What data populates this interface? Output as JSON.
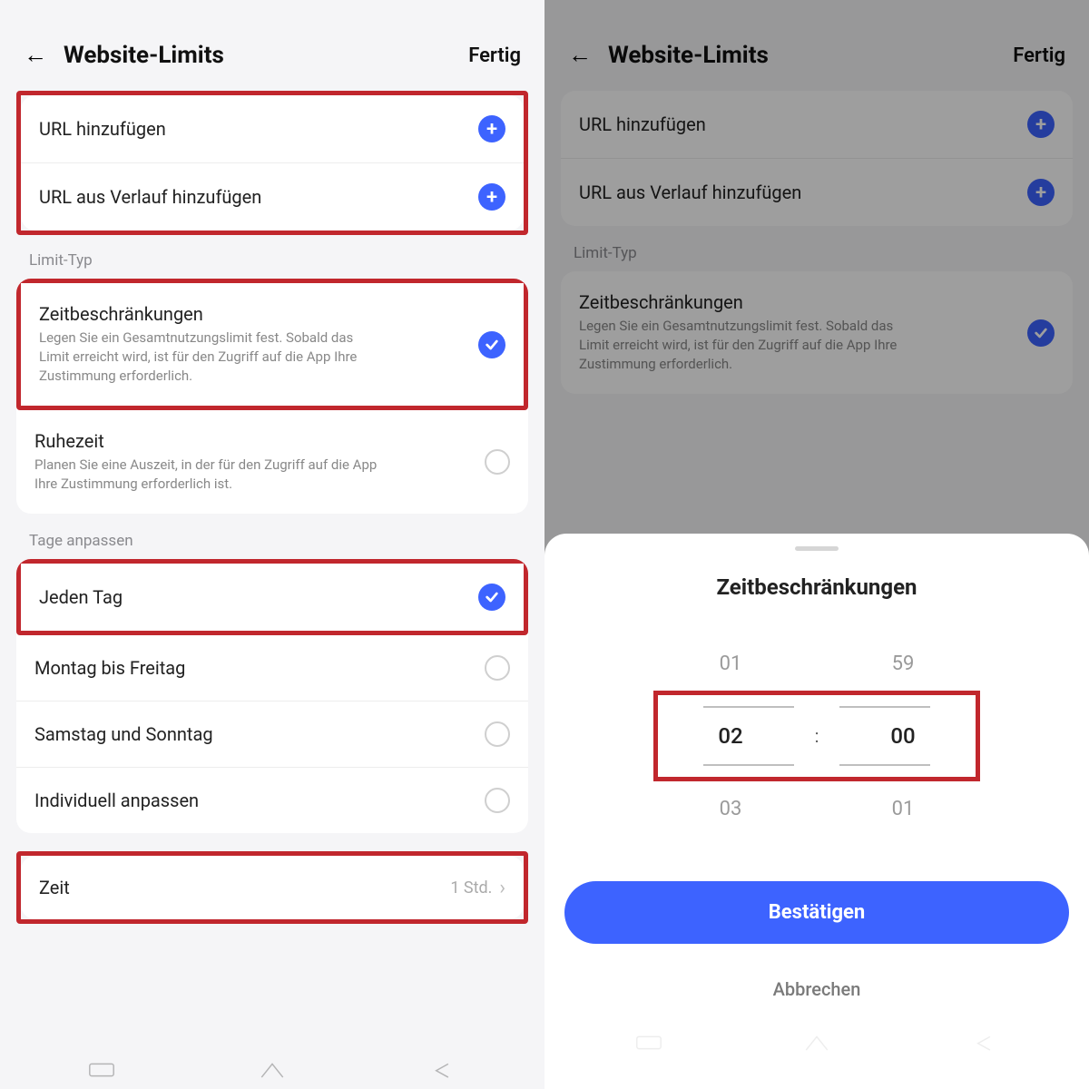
{
  "header": {
    "title": "Website-Limits",
    "done": "Fertig"
  },
  "url_section": {
    "add_url": "URL hinzufügen",
    "add_url_history": "URL aus Verlauf hinzufügen"
  },
  "limit_type": {
    "section_label": "Limit-Typ",
    "time_limits": {
      "title": "Zeitbeschränkungen",
      "desc": "Legen Sie ein Gesamtnutzungslimit fest. Sobald das Limit erreicht wird, ist für den Zugriff auf die App Ihre Zustimmung erforderlich."
    },
    "rest": {
      "title": "Ruhezeit",
      "desc": "Planen Sie eine Auszeit, in der für den Zugriff auf die App Ihre Zustimmung erforderlich ist."
    }
  },
  "days": {
    "section_label": "Tage anpassen",
    "every_day": "Jeden Tag",
    "mon_fri": "Montag bis Freitag",
    "sat_sun": "Samstag und Sonntag",
    "custom": "Individuell anpassen"
  },
  "time": {
    "label": "Zeit",
    "value": "1 Std."
  },
  "sheet": {
    "title": "Zeitbeschränkungen",
    "hours_prev": "01",
    "minutes_prev": "59",
    "hours_curr": "02",
    "minutes_curr": "00",
    "hours_next": "03",
    "minutes_next": "01",
    "confirm": "Bestätigen",
    "cancel": "Abbrechen",
    "separator": ":"
  },
  "colors": {
    "accent": "#3d63ff",
    "highlight": "#c1272d"
  }
}
